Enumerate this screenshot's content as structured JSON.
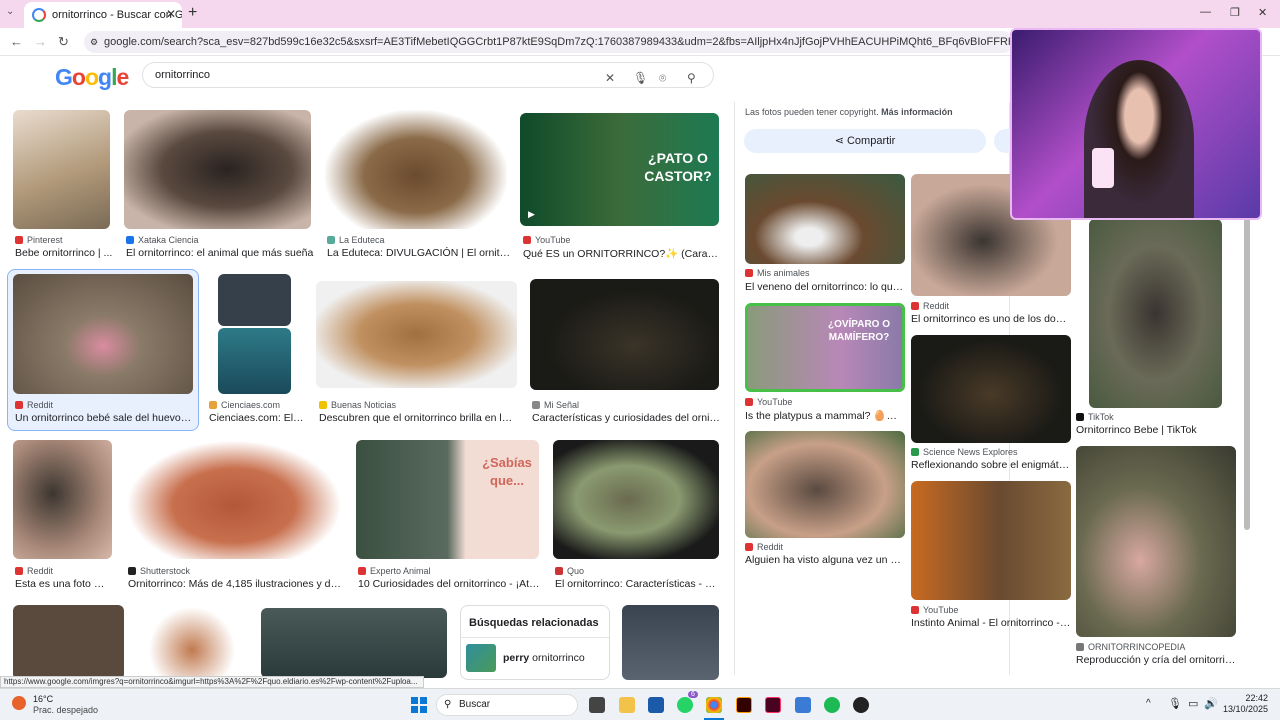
{
  "browser": {
    "tab_title": "ornitorrinco - Buscar con Goog",
    "url": "google.com/search?sca_esv=827bd599c16e32c5&sxsrf=AE3TifMebetIQGGCrbt1P87ktE9SqDm7zQ:1760387989433&udm=2&fbs=AIljpHx4nJjfGojPVHhEACUHPiMQht6_BFq6vBIoFFRK7qchKEWEvuc0Hbw31oEl7c8o3y7MfN"
  },
  "search": {
    "logo": "Google",
    "query": "ornitorrinco"
  },
  "images": [
    {
      "source": "Pinterest",
      "title": "Bebe ornitorrinco | ..."
    },
    {
      "source": "Xataka Ciencia",
      "title": "El ornitorrinco: el animal que más sueña"
    },
    {
      "source": "La Eduteca",
      "title": "La Eduteca: DIVULGACIÓN | El ornitor..."
    },
    {
      "source": "YouTube",
      "title": "Qué ES un ORNITORRINCO?✨ (Caracter...",
      "overlay": "¿PATO O CASTOR?"
    },
    {
      "source": "Reddit",
      "title": "Un ornitorrinco bebé sale del huevo si..."
    },
    {
      "source": "Cienciaes.com",
      "title": "Cienciaes.com: El ..."
    },
    {
      "source": "Buenas Noticias",
      "title": "Descubren que el ornitorrinco brilla en la o..."
    },
    {
      "source": "Mi Señal",
      "title": "Características y curiosidades del ornitor..."
    },
    {
      "source": "Reddit",
      "title": "Esta es una foto de..."
    },
    {
      "source": "Shutterstock",
      "title": "Ornitorrinco: Más de 4,185 ilustraciones y dibuj..."
    },
    {
      "source": "Experto Animal",
      "title": "10 Curiosidades del ornitorrinco - ¡Atento!",
      "overlay": "¿Sabías que..."
    },
    {
      "source": "Quo",
      "title": "El ornitorrinco: Características - Quo"
    }
  ],
  "related": {
    "heading": "Búsquedas relacionadas",
    "item_bold": "perry",
    "item_rest": " ornitorrinco"
  },
  "panel": {
    "copyright": "Las fotos pueden tener copyright.",
    "more": "Más información",
    "share": "Compartir",
    "items": [
      {
        "source": "Mis animales",
        "title": "El veneno del ornitorrinco: lo que d..."
      },
      {
        "source": "Reddit",
        "title": "El ornitorrinco es uno de los dos ú..."
      },
      {
        "source": "TikTok",
        "title": "Ornitorrinco Bebe | TikTok"
      },
      {
        "source": "YouTube",
        "title": "Is the platypus a mammal? 🥚🐊 |...",
        "overlay": "¿OVÍPARO O MAMÍFERO?"
      },
      {
        "source": "Science News Explores",
        "title": "Reflexionando sobre el enigmático..."
      },
      {
        "source": "Reddit",
        "title": "Alguien ha visto alguna vez un orni..."
      },
      {
        "source": "YouTube",
        "title": "Instinto Animal - El ornitorrinco - Yo..."
      },
      {
        "source": "ORNITORRINCOPEDIA",
        "title": "Reproducción y cría del ornitorrinc..."
      }
    ]
  },
  "status_url": "https://www.google.com/imgres?q=ornitorrinco&imgurl=https%3A%2F%2Fquo.eldiario.es%2Fwp-content%2Fuploa...",
  "taskbar": {
    "temp": "16°C",
    "weather": "Prac. despejado",
    "search": "Buscar",
    "time": "22:42",
    "date": "13/10/2025",
    "badge": "6"
  }
}
